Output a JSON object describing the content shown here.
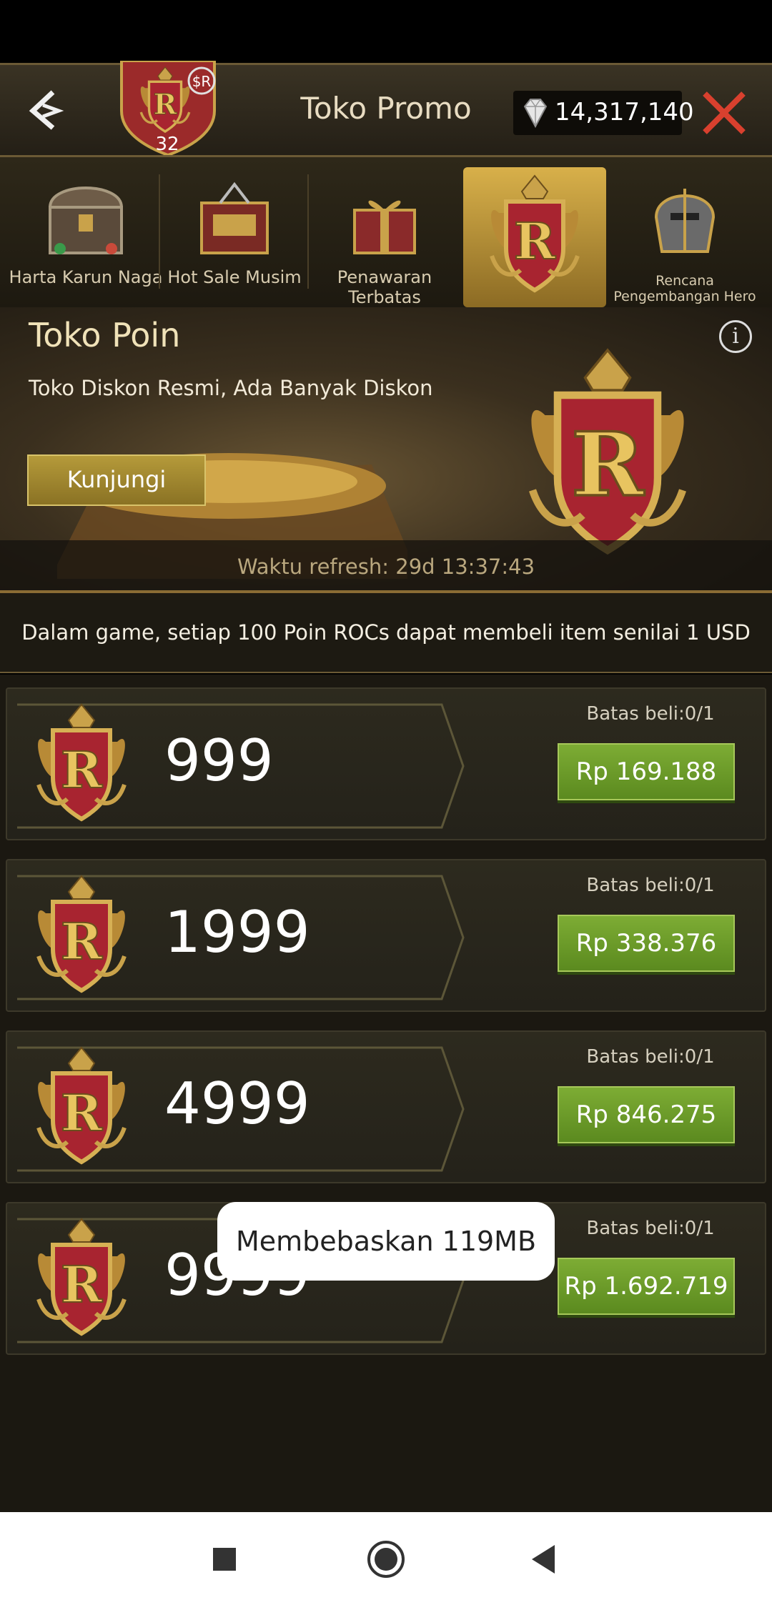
{
  "header": {
    "title": "Toko Promo",
    "level": "32",
    "diamonds": "14,317,140"
  },
  "tabs": [
    {
      "label": "Harta Karun Naga",
      "icon": "treasure-chest-icon"
    },
    {
      "label": "Hot Sale Musim",
      "icon": "chest-icon"
    },
    {
      "label": "Penawaran Terbatas",
      "icon": "gift-box-icon"
    },
    {
      "label": "",
      "icon": "r-emblem-icon",
      "active": true
    },
    {
      "label": "Rencana Pengembangan Hero",
      "icon": "helmet-icon"
    }
  ],
  "banner": {
    "title": "Toko Poin",
    "subtitle": "Toko Diskon Resmi, Ada Banyak Diskon",
    "visit_label": "Kunjungi",
    "refresh": "Waktu refresh: 29d 13:37:43"
  },
  "note": "Dalam game, setiap 100 Poin ROCs dapat membeli item senilai 1 USD",
  "offers": [
    {
      "amount": "999",
      "limit": "Batas beli:0/1",
      "price": "Rp 169.188"
    },
    {
      "amount": "1999",
      "limit": "Batas beli:0/1",
      "price": "Rp 338.376"
    },
    {
      "amount": "4999",
      "limit": "Batas beli:0/1",
      "price": "Rp 846.275"
    },
    {
      "amount": "9999",
      "limit": "Batas beli:0/1",
      "price": "Rp 1.692.719"
    }
  ],
  "toast": "Membebaskan 119MB",
  "colors": {
    "accent_gold": "#d8b04a",
    "buy_green": "#6e9e2a",
    "close_red": "#d9402e"
  }
}
